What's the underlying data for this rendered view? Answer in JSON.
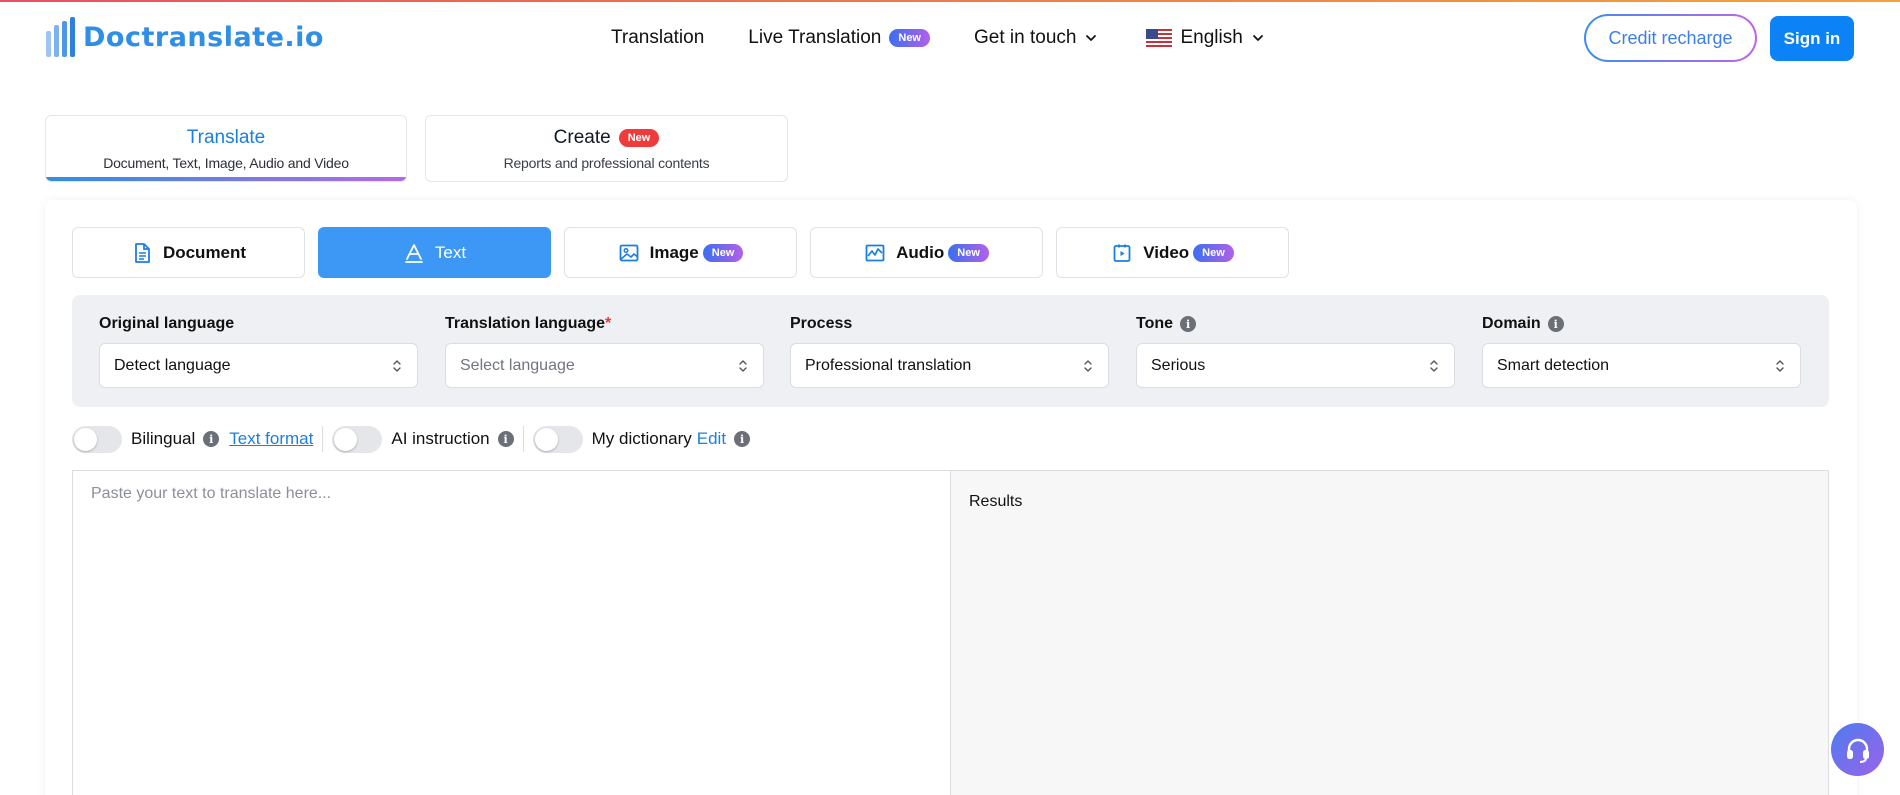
{
  "header": {
    "logo_text": "Doctranslate.io",
    "nav": {
      "translation": "Translation",
      "live_translation": "Live Translation",
      "live_badge": "New",
      "get_in_touch": "Get in touch",
      "language": "English"
    },
    "credit_recharge": "Credit recharge",
    "sign_in": "Sign in"
  },
  "modes": {
    "translate": {
      "title": "Translate",
      "subtitle": "Document, Text, Image, Audio and Video"
    },
    "create": {
      "title": "Create",
      "badge": "New",
      "subtitle": "Reports and professional contents"
    }
  },
  "type_tabs": {
    "document": {
      "label": "Document"
    },
    "text": {
      "label": "Text"
    },
    "image": {
      "label": "Image",
      "badge": "New"
    },
    "audio": {
      "label": "Audio",
      "badge": "New"
    },
    "video": {
      "label": "Video",
      "badge": "New"
    }
  },
  "settings": {
    "original": {
      "label": "Original language",
      "value": "Detect language"
    },
    "translation": {
      "label": "Translation language",
      "required": "*",
      "placeholder": "Select language"
    },
    "process": {
      "label": "Process",
      "value": "Professional translation"
    },
    "tone": {
      "label": "Tone",
      "value": "Serious"
    },
    "domain": {
      "label": "Domain",
      "value": "Smart detection"
    }
  },
  "toggles": {
    "bilingual": "Bilingual",
    "text_format": "Text format",
    "ai_instruction": "AI instruction",
    "my_dictionary": "My dictionary",
    "edit": "Edit"
  },
  "editor": {
    "placeholder": "Paste your text to translate here...",
    "results": "Results"
  },
  "colors": {
    "brand_blue": "#2f8ee6",
    "active_tab": "#3d98f5",
    "sign_in": "#0b82f5",
    "new_badge_start": "#3b6ff0",
    "new_badge_end": "#b260e8",
    "create_badge": "#ef3b3b"
  },
  "icons": {
    "info": "info-icon",
    "chevron": "chevron-down-icon",
    "support": "headset-icon"
  }
}
